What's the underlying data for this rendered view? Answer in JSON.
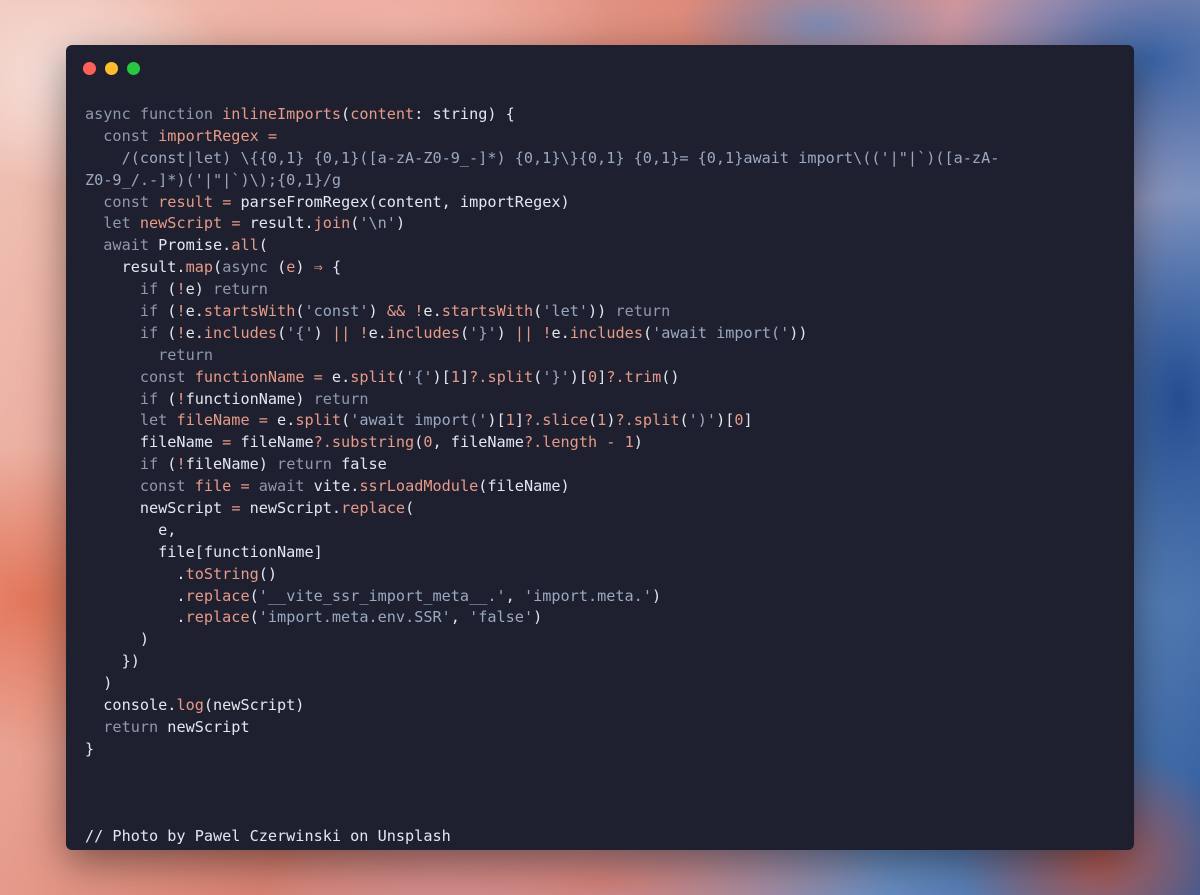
{
  "window": {
    "controls": [
      {
        "name": "close-button",
        "color": "#ff5f57"
      },
      {
        "name": "minimize-button",
        "color": "#febc2e"
      },
      {
        "name": "maximize-button",
        "color": "#28c840"
      }
    ]
  },
  "theme": {
    "background": "#1e2030",
    "keyword": "#8e99ac",
    "function": "#e69a88",
    "string": "#9aa8c0",
    "text": "#e4e6ee"
  },
  "code": {
    "lines": [
      [
        [
          "kw",
          "async function "
        ],
        [
          "fn",
          "inlineImports"
        ],
        [
          "plain",
          "("
        ],
        [
          "var",
          "content"
        ],
        [
          "plain",
          ": string) {"
        ]
      ],
      [
        [
          "kw",
          "  const "
        ],
        [
          "var",
          "importRegex"
        ],
        [
          "plain",
          " "
        ],
        [
          "op",
          "="
        ]
      ],
      [
        [
          "regex",
          "    /(const|let) \\{{0,1} {0,1}([a-zA-Z0-9_-]*) {0,1}\\}{0,1} {0,1}= {0,1}await import\\(('|\"|`)([a-zA-"
        ]
      ],
      [
        [
          "regex",
          "Z0-9_/.-]*)('|\"|`)\\);{0,1}/g"
        ]
      ],
      [
        [
          "kw",
          "  const "
        ],
        [
          "var",
          "result"
        ],
        [
          "plain",
          " "
        ],
        [
          "op",
          "="
        ],
        [
          "plain",
          " parseFromRegex(content, importRegex)"
        ]
      ],
      [
        [
          "kw",
          "  let "
        ],
        [
          "var",
          "newScript"
        ],
        [
          "plain",
          " "
        ],
        [
          "op",
          "="
        ],
        [
          "plain",
          " result."
        ],
        [
          "fn",
          "join"
        ],
        [
          "plain",
          "("
        ],
        [
          "str",
          "'\\n'"
        ],
        [
          "plain",
          ")"
        ]
      ],
      [
        [
          "kw",
          "  await "
        ],
        [
          "plain",
          "Promise."
        ],
        [
          "fn",
          "all"
        ],
        [
          "plain",
          "("
        ]
      ],
      [
        [
          "plain",
          "    result."
        ],
        [
          "fn",
          "map"
        ],
        [
          "plain",
          "("
        ],
        [
          "kw",
          "async "
        ],
        [
          "plain",
          "("
        ],
        [
          "var",
          "e"
        ],
        [
          "plain",
          ") "
        ],
        [
          "op",
          "⇒"
        ],
        [
          "plain",
          " {"
        ]
      ],
      [
        [
          "kw",
          "      if "
        ],
        [
          "plain",
          "("
        ],
        [
          "op",
          "!"
        ],
        [
          "plain",
          "e) "
        ],
        [
          "kw",
          "return"
        ]
      ],
      [
        [
          "kw",
          "      if "
        ],
        [
          "plain",
          "("
        ],
        [
          "op",
          "!"
        ],
        [
          "plain",
          "e."
        ],
        [
          "fn",
          "startsWith"
        ],
        [
          "plain",
          "("
        ],
        [
          "str",
          "'const'"
        ],
        [
          "plain",
          ") "
        ],
        [
          "op",
          "&&"
        ],
        [
          "plain",
          " "
        ],
        [
          "op",
          "!"
        ],
        [
          "plain",
          "e."
        ],
        [
          "fn",
          "startsWith"
        ],
        [
          "plain",
          "("
        ],
        [
          "str",
          "'let'"
        ],
        [
          "plain",
          ")) "
        ],
        [
          "kw",
          "return"
        ]
      ],
      [
        [
          "kw",
          "      if "
        ],
        [
          "plain",
          "("
        ],
        [
          "op",
          "!"
        ],
        [
          "plain",
          "e."
        ],
        [
          "fn",
          "includes"
        ],
        [
          "plain",
          "("
        ],
        [
          "str",
          "'{'"
        ],
        [
          "plain",
          ") "
        ],
        [
          "op",
          "||"
        ],
        [
          "plain",
          " "
        ],
        [
          "op",
          "!"
        ],
        [
          "plain",
          "e."
        ],
        [
          "fn",
          "includes"
        ],
        [
          "plain",
          "("
        ],
        [
          "str",
          "'}'"
        ],
        [
          "plain",
          ") "
        ],
        [
          "op",
          "||"
        ],
        [
          "plain",
          " "
        ],
        [
          "op",
          "!"
        ],
        [
          "plain",
          "e."
        ],
        [
          "fn",
          "includes"
        ],
        [
          "plain",
          "("
        ],
        [
          "str",
          "'await import('"
        ],
        [
          "plain",
          "))"
        ]
      ],
      [
        [
          "kw",
          "        return"
        ]
      ],
      [
        [
          "kw",
          "      const "
        ],
        [
          "var",
          "functionName"
        ],
        [
          "plain",
          " "
        ],
        [
          "op",
          "="
        ],
        [
          "plain",
          " e."
        ],
        [
          "fn",
          "split"
        ],
        [
          "plain",
          "("
        ],
        [
          "str",
          "'{'"
        ],
        [
          "plain",
          ")["
        ],
        [
          "num",
          "1"
        ],
        [
          "plain",
          "]"
        ],
        [
          "op",
          "?."
        ],
        [
          "fn",
          "split"
        ],
        [
          "plain",
          "("
        ],
        [
          "str",
          "'}'"
        ],
        [
          "plain",
          ")["
        ],
        [
          "num",
          "0"
        ],
        [
          "plain",
          "]"
        ],
        [
          "op",
          "?."
        ],
        [
          "fn",
          "trim"
        ],
        [
          "plain",
          "()"
        ]
      ],
      [
        [
          "kw",
          "      if "
        ],
        [
          "plain",
          "("
        ],
        [
          "op",
          "!"
        ],
        [
          "plain",
          "functionName) "
        ],
        [
          "kw",
          "return"
        ]
      ],
      [
        [
          "kw",
          "      let "
        ],
        [
          "var",
          "fileName"
        ],
        [
          "plain",
          " "
        ],
        [
          "op",
          "="
        ],
        [
          "plain",
          " e."
        ],
        [
          "fn",
          "split"
        ],
        [
          "plain",
          "("
        ],
        [
          "str",
          "'await import('"
        ],
        [
          "plain",
          ")["
        ],
        [
          "num",
          "1"
        ],
        [
          "plain",
          "]"
        ],
        [
          "op",
          "?."
        ],
        [
          "fn",
          "slice"
        ],
        [
          "plain",
          "("
        ],
        [
          "num",
          "1"
        ],
        [
          "plain",
          ")"
        ],
        [
          "op",
          "?."
        ],
        [
          "fn",
          "split"
        ],
        [
          "plain",
          "("
        ],
        [
          "str",
          "')'"
        ],
        [
          "plain",
          ")["
        ],
        [
          "num",
          "0"
        ],
        [
          "plain",
          "]"
        ]
      ],
      [
        [
          "plain",
          "      fileName "
        ],
        [
          "op",
          "="
        ],
        [
          "plain",
          " fileName"
        ],
        [
          "op",
          "?."
        ],
        [
          "fn",
          "substring"
        ],
        [
          "plain",
          "("
        ],
        [
          "num",
          "0"
        ],
        [
          "plain",
          ", fileName"
        ],
        [
          "op",
          "?."
        ],
        [
          "fn",
          "length"
        ],
        [
          "plain",
          " "
        ],
        [
          "op",
          "-"
        ],
        [
          "plain",
          " "
        ],
        [
          "num",
          "1"
        ],
        [
          "plain",
          ")"
        ]
      ],
      [
        [
          "kw",
          "      if "
        ],
        [
          "plain",
          "("
        ],
        [
          "op",
          "!"
        ],
        [
          "plain",
          "fileName) "
        ],
        [
          "kw",
          "return "
        ],
        [
          "plain",
          "false"
        ]
      ],
      [
        [
          "kw",
          "      const "
        ],
        [
          "var",
          "file"
        ],
        [
          "plain",
          " "
        ],
        [
          "op",
          "="
        ],
        [
          "kw",
          " await "
        ],
        [
          "plain",
          "vite."
        ],
        [
          "fn",
          "ssrLoadModule"
        ],
        [
          "plain",
          "(fileName)"
        ]
      ],
      [
        [
          "plain",
          "      newScript "
        ],
        [
          "op",
          "="
        ],
        [
          "plain",
          " newScript."
        ],
        [
          "fn",
          "replace"
        ],
        [
          "plain",
          "("
        ]
      ],
      [
        [
          "plain",
          "        e,"
        ]
      ],
      [
        [
          "plain",
          "        file[functionName]"
        ]
      ],
      [
        [
          "plain",
          "          ."
        ],
        [
          "fn",
          "toString"
        ],
        [
          "plain",
          "()"
        ]
      ],
      [
        [
          "plain",
          "          ."
        ],
        [
          "fn",
          "replace"
        ],
        [
          "plain",
          "("
        ],
        [
          "str",
          "'__vite_ssr_import_meta__.'"
        ],
        [
          "plain",
          ", "
        ],
        [
          "str",
          "'import.meta.'"
        ],
        [
          "plain",
          ")"
        ]
      ],
      [
        [
          "plain",
          "          ."
        ],
        [
          "fn",
          "replace"
        ],
        [
          "plain",
          "("
        ],
        [
          "str",
          "'import.meta.env.SSR'"
        ],
        [
          "plain",
          ", "
        ],
        [
          "str",
          "'false'"
        ],
        [
          "plain",
          ")"
        ]
      ],
      [
        [
          "plain",
          "      )"
        ]
      ],
      [
        [
          "plain",
          "    })"
        ]
      ],
      [
        [
          "plain",
          "  )"
        ]
      ],
      [
        [
          "plain",
          "  console."
        ],
        [
          "fn",
          "log"
        ],
        [
          "plain",
          "(newScript)"
        ]
      ],
      [
        [
          "kw",
          "  return "
        ],
        [
          "plain",
          "newScript"
        ]
      ],
      [
        [
          "plain",
          "}"
        ]
      ],
      [
        [
          "plain",
          ""
        ]
      ],
      [
        [
          "plain",
          ""
        ]
      ],
      [
        [
          "plain",
          ""
        ]
      ],
      [
        [
          "comment",
          "// Photo by Pawel Czerwinski on Unsplash"
        ]
      ]
    ]
  }
}
